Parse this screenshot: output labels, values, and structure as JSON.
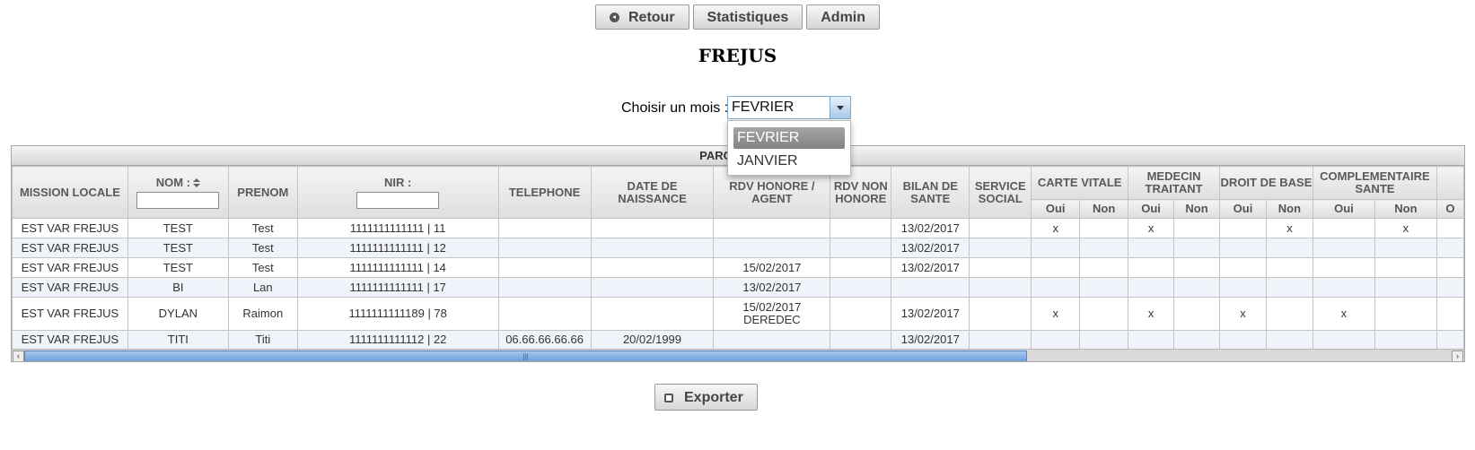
{
  "nav": {
    "retour": "Retour",
    "statistiques": "Statistiques",
    "admin": "Admin"
  },
  "page_title": "FREJUS",
  "month_picker": {
    "label": "Choisir un mois :",
    "value": "FEVRIER",
    "options": [
      "FEVRIER",
      "JANVIER"
    ]
  },
  "grid": {
    "caption": "PARCOURS S",
    "headers": {
      "mission_locale": "MISSION LOCALE",
      "nom": "NOM :",
      "prenom": "PRENOM",
      "nir": "NIR :",
      "telephone": "TELEPHONE",
      "date_naissance": "DATE DE NAISSANCE",
      "rdv_honore": "RDV HONORE / AGENT",
      "rdv_non_honore": "RDV NON HONORE",
      "bilan_sante": "BILAN DE SANTE",
      "service_social": "SERVICE SOCIAL",
      "carte_vitale": "CARTE VITALE",
      "medecin_traitant": "MEDECIN TRAITANT",
      "droit_base": "DROIT DE BASE",
      "complementaire_sante": "COMPLEMENTAIRE SANTE",
      "oui": "Oui",
      "non": "Non",
      "next_sub": "O"
    },
    "rows": [
      [
        "EST VAR FREJUS",
        "TEST",
        "Test",
        "1111111111111 | 11",
        "",
        "",
        "",
        "",
        "13/02/2017",
        "",
        "x",
        "",
        "x",
        "",
        "",
        "x",
        "",
        "x",
        ""
      ],
      [
        "EST VAR FREJUS",
        "TEST",
        "Test",
        "1111111111111 | 12",
        "",
        "",
        "",
        "",
        "13/02/2017",
        "",
        "",
        "",
        "",
        "",
        "",
        "",
        "",
        "",
        ""
      ],
      [
        "EST VAR FREJUS",
        "TEST",
        "Test",
        "1111111111111 | 14",
        "",
        "",
        "15/02/2017",
        "",
        "13/02/2017",
        "",
        "",
        "",
        "",
        "",
        "",
        "",
        "",
        "",
        ""
      ],
      [
        "EST VAR FREJUS",
        "BI",
        "Lan",
        "1111111111111 | 17",
        "",
        "",
        "13/02/2017",
        "",
        "",
        "",
        "",
        "",
        "",
        "",
        "",
        "",
        "",
        "",
        ""
      ],
      [
        "EST VAR FREJUS",
        "DYLAN",
        "Raimon",
        "1111111111189 | 78",
        "",
        "",
        "15/02/2017 DEREDEC",
        "",
        "13/02/2017",
        "",
        "x",
        "",
        "x",
        "",
        "x",
        "",
        "x",
        "",
        ""
      ],
      [
        "EST VAR FREJUS",
        "TITI",
        "Titi",
        "1111111111112 | 22",
        "06.66.66.66.66",
        "20/02/1999",
        "",
        "",
        "13/02/2017",
        "",
        "",
        "",
        "",
        "",
        "",
        "",
        "",
        "",
        ""
      ]
    ]
  },
  "export_label": "Exporter"
}
